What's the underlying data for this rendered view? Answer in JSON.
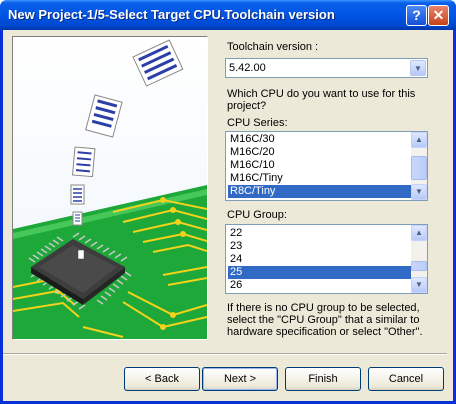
{
  "window": {
    "title": "New Project-1/5-Select Target CPU.Toolchain version",
    "help_glyph": "?",
    "close_glyph": "✕"
  },
  "toolchain": {
    "label": "Toolchain version :",
    "value": "5.42.00"
  },
  "question": {
    "line1": "Which CPU do you want to use for this",
    "line2": "project?"
  },
  "cpu_series": {
    "label": "CPU Series:",
    "items": [
      "M16C/30",
      "M16C/20",
      "M16C/10",
      "M16C/Tiny",
      "R8C/Tiny"
    ],
    "selected": "R8C/Tiny"
  },
  "cpu_group": {
    "label": "CPU Group:",
    "items": [
      "22",
      "23",
      "24",
      "25",
      "26"
    ],
    "selected": "25"
  },
  "hint": {
    "line1": "If there is no CPU group to be selected,",
    "line2": "select the \"CPU Group\" that a similar to",
    "line3": "hardware specification or select \"Other\"."
  },
  "buttons": {
    "back": "< Back",
    "next": "Next >",
    "finish": "Finish",
    "cancel": "Cancel"
  },
  "colors": {
    "title_bar": "#0055e5",
    "selection": "#316ac5",
    "board_green": "#1ea83a",
    "trace_yellow": "#f2d21b",
    "dialog_bg": "#ece9d8"
  },
  "icons": {
    "help": "help-icon",
    "close": "close-icon",
    "dropdown": "chevron-down-icon",
    "scroll_up": "scroll-up-icon",
    "scroll_down": "scroll-down-icon"
  }
}
